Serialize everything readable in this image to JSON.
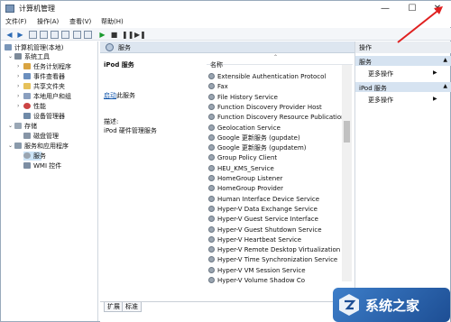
{
  "window": {
    "title": "计算机管理",
    "controls": {
      "minimize": "—",
      "maximize": "☐",
      "close": "✕"
    }
  },
  "menu": [
    {
      "label": "文件(F)"
    },
    {
      "label": "操作(A)"
    },
    {
      "label": "查看(V)"
    },
    {
      "label": "帮助(H)"
    }
  ],
  "tree": {
    "root": "计算机管理(本地)",
    "system_tools": "系统工具",
    "task_scheduler": "任务计划程序",
    "event_viewer": "事件查看器",
    "shared_folders": "共享文件夹",
    "local_users": "本地用户和组",
    "performance": "性能",
    "device_manager": "设备管理器",
    "storage": "存储",
    "disk_management": "磁盘管理",
    "services_apps": "服务和应用程序",
    "services": "服务",
    "wmi": "WMI 控件"
  },
  "center": {
    "header": "服务",
    "selected_service": "iPod 服务",
    "action_link": "启动",
    "action_suffix": "此服务",
    "desc_label": "描述:",
    "desc_text": "iPod 硬件管理服务",
    "column_name": "名称",
    "services": [
      "Extensible Authentication Protocol",
      "Fax",
      "File History Service",
      "Function Discovery Provider Host",
      "Function Discovery Resource Publication",
      "Geolocation Service",
      "Google 更新服务 (gupdate)",
      "Google 更新服务 (gupdatem)",
      "Group Policy Client",
      "HEU_KMS_Service",
      "HomeGroup Listener",
      "HomeGroup Provider",
      "Human Interface Device Service",
      "Hyper-V Data Exchange Service",
      "Hyper-V Guest Service Interface",
      "Hyper-V Guest Shutdown Service",
      "Hyper-V Heartbeat Service",
      "Hyper-V Remote Desktop Virtualization ...",
      "Hyper-V Time Synchronization Service",
      "Hyper-V VM Session Service",
      "Hyper-V Volume Shadow Co"
    ],
    "tabs": [
      "扩展",
      "标准"
    ]
  },
  "actions": {
    "header": "操作",
    "section1": "服务",
    "section1_item": "更多操作",
    "section2": "iPod 服务",
    "section2_item": "更多操作"
  },
  "watermark": {
    "text": "系统之家"
  },
  "colors": {
    "selection": "#cce4f7",
    "accent": "#1d4e94",
    "annotation": "#e02020"
  }
}
